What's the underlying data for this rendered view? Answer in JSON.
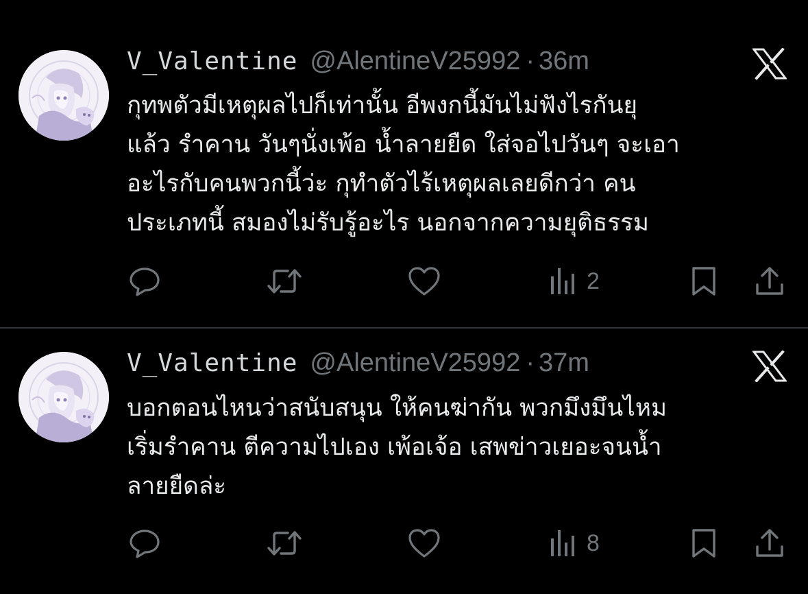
{
  "colors": {
    "background": "#000000",
    "text": "#e7e9ea",
    "secondary": "#71767b",
    "divider": "#2f3336"
  },
  "tweets": [
    {
      "display_name": "V_Valentine",
      "handle": "@AlentineV25992",
      "separator": "·",
      "time": "36m",
      "lines": [
        "กุทพตัวมีเหตุผลไปก็เท่านั้น อีพงกนี้มันไม่ฟังไรกันยุ",
        "แล้ว รำคาน วันๆนั่งเพ้อ น้ำลายยืด ใส่จอไปวันๆ จะเอา",
        "อะไรกับคนพวกนี้ว่ะ กุทำตัวไร้เหตุผลเลยดีกว่า คน",
        "ประเภทนี้ สมองไม่รับรู้อะไร นอกจากความยุติธรรม"
      ],
      "views": "2",
      "icons": [
        "reply-icon",
        "retweet-icon",
        "like-icon",
        "views-icon",
        "bookmark-icon",
        "share-icon",
        "x-logo-icon"
      ]
    },
    {
      "display_name": "V_Valentine",
      "handle": "@AlentineV25992",
      "separator": "·",
      "time": "37m",
      "lines": [
        "บอกตอนไหนว่าสนับสนุน ให้คนฆ่ากัน พวกมึงมึนไหม",
        "เริ่มรำคาน ตีความไปเอง เพ้อเจ้อ เสพข่าวเยอะจนน้ำ",
        "ลายยืดล่ะ"
      ],
      "views": "8",
      "icons": [
        "reply-icon",
        "retweet-icon",
        "like-icon",
        "views-icon",
        "bookmark-icon",
        "share-icon",
        "x-logo-icon"
      ]
    }
  ]
}
